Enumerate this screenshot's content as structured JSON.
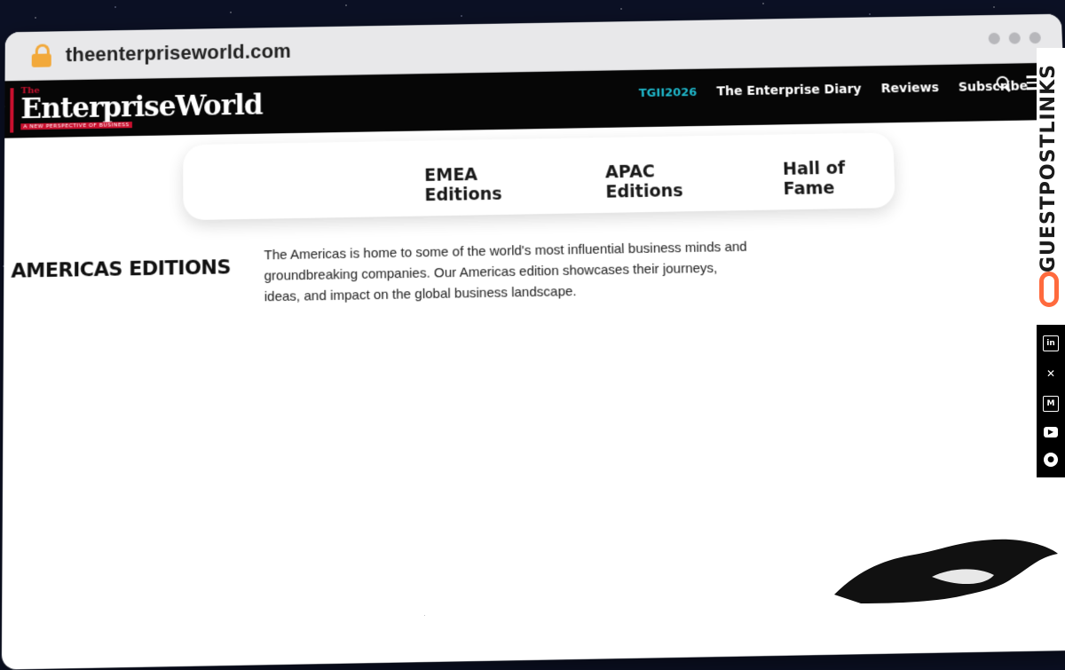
{
  "browser": {
    "url": "theenterpriseworld.com"
  },
  "header": {
    "logo_small": "The",
    "logo_name": "EnterpriseWorld",
    "logo_tagline": "A NEW PERSPECTIVE OF BUSINESS",
    "nav": [
      {
        "label": "TGII2026"
      },
      {
        "label": "The Enterprise Diary"
      },
      {
        "label": "Reviews"
      },
      {
        "label": "Subscribe"
      }
    ],
    "icons": [
      "search-icon",
      "menu-icon"
    ]
  },
  "editions": {
    "links": [
      {
        "label": "EMEA Editions"
      },
      {
        "label": "APAC Editions"
      },
      {
        "label": "Hall of Fame"
      }
    ]
  },
  "main": {
    "title": "AMERICAS EDITIONS",
    "intro": "The Americas is home to some of the world's most influential business minds and groundbreaking companies. Our Americas edition showcases their journeys, ideas, and impact on the global business landscape."
  },
  "sidebar": {
    "brand": "GUESTPOSTLINKS",
    "social_icons": [
      "linkedin-icon",
      "x-icon",
      "medium-icon",
      "youtube-icon",
      "reddit-icon"
    ]
  },
  "colors": {
    "accent": "#1fb6c9",
    "brand_red": "#c8102e",
    "orange": "#ff6a3d",
    "lock": "#f2a93b"
  }
}
